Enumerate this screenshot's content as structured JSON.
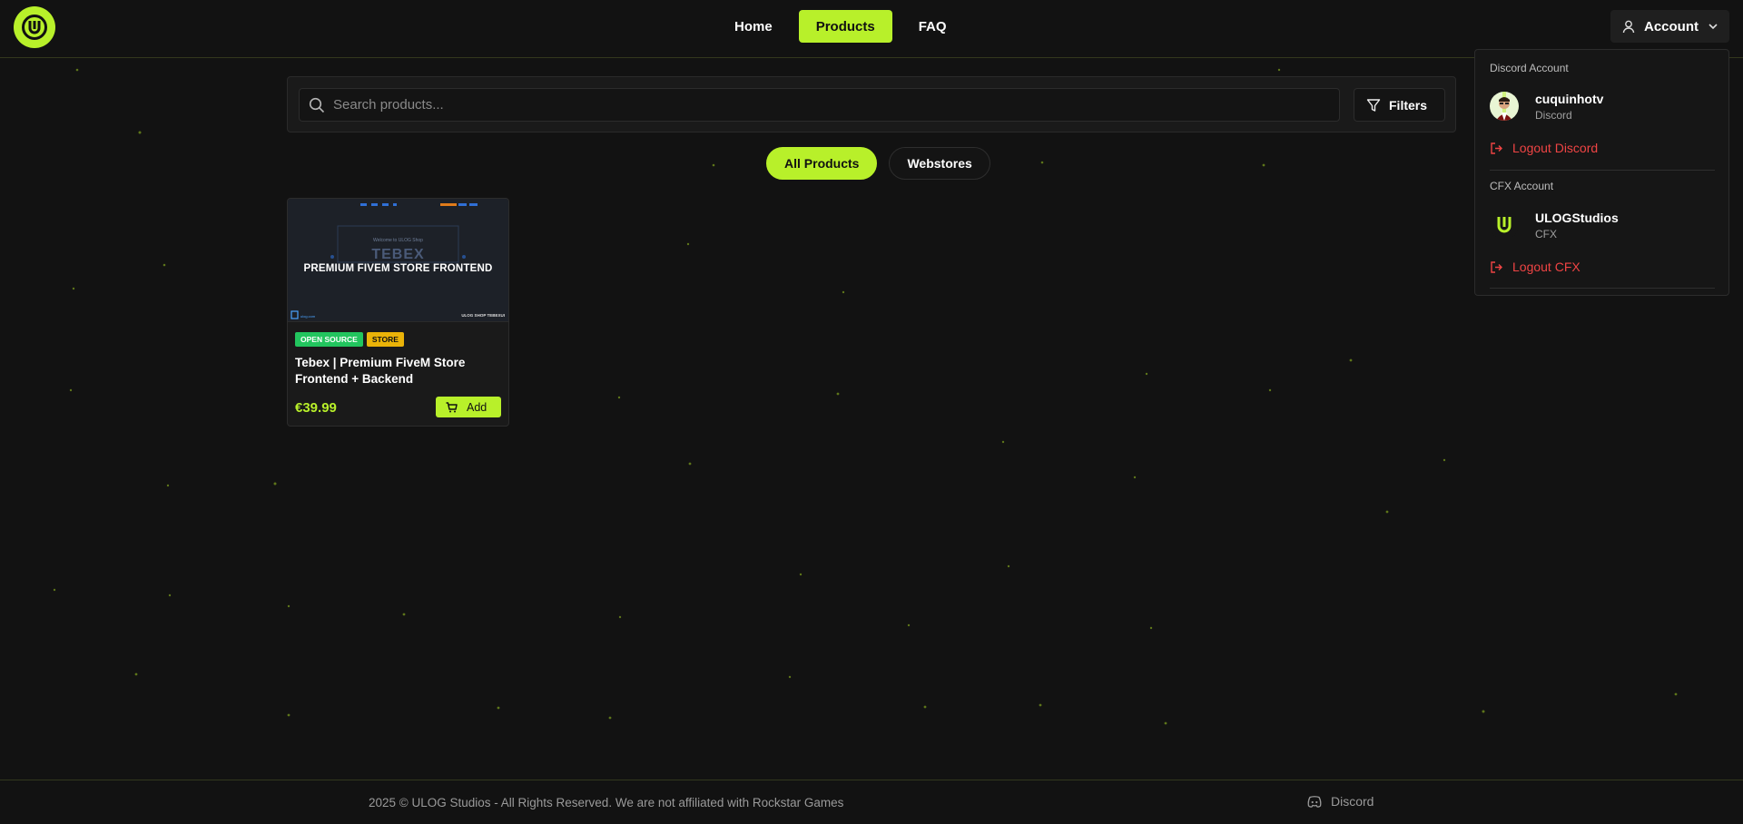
{
  "header": {
    "nav": [
      {
        "label": "Home",
        "active": false
      },
      {
        "label": "Products",
        "active": true
      },
      {
        "label": "FAQ",
        "active": false
      }
    ],
    "account_label": "Account"
  },
  "search": {
    "placeholder": "Search products...",
    "filters_label": "Filters"
  },
  "categories": [
    {
      "label": "All Products",
      "active": true
    },
    {
      "label": "Webstores",
      "active": false
    }
  ],
  "product": {
    "image": {
      "welcome": "Welcome to ULOG Shop",
      "big_word": "TEBEX",
      "title": "PREMIUM FIVEM STORE FRONTEND",
      "footer_left": "ulog.com",
      "footer_right": "ULOG SHOP TEBEXUI"
    },
    "tags": [
      "OPEN SOURCE",
      "STORE"
    ],
    "title": "Tebex | Premium FiveM Store Frontend + Backend",
    "price": "€39.99",
    "add_label": "Add"
  },
  "account_menu": {
    "discord_section": "Discord Account",
    "discord_user": "cuquinhotv",
    "discord_sub": "Discord",
    "discord_logout": "Logout Discord",
    "cfx_section": "CFX Account",
    "cfx_user": "ULOGStudios",
    "cfx_sub": "CFX",
    "cfx_logout": "Logout CFX"
  },
  "footer": {
    "copyright": "2025 © ULOG Studios - All Rights Reserved. We are not affiliated with Rockstar Games",
    "discord_label": "Discord"
  },
  "colors": {
    "accent": "#b8f02a",
    "background": "#121212",
    "danger": "#ef4444"
  }
}
